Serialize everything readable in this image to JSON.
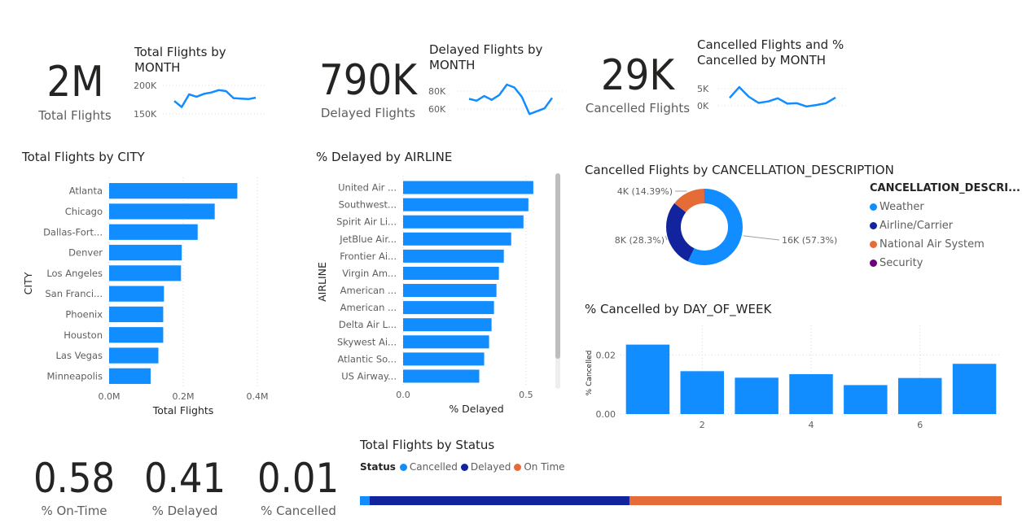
{
  "kpis": {
    "total_flights": {
      "value": "2M",
      "label": "Total Flights"
    },
    "delayed_flights": {
      "value": "790K",
      "label": "Delayed Flights"
    },
    "cancelled_flights": {
      "value": "29K",
      "label": "Cancelled Flights"
    },
    "on_time_pct": {
      "value": "0.58",
      "label": "% On-Time"
    },
    "delayed_pct": {
      "value": "0.41",
      "label": "% Delayed"
    },
    "cancelled_pct": {
      "value": "0.01",
      "label": "% Cancelled"
    }
  },
  "colors": {
    "blue": "#118DFF",
    "navy": "#12239E",
    "orange": "#E66C37",
    "purple": "#6B007B",
    "grid": "#d9d9d9",
    "text": "#252423",
    "muted": "#605e5c"
  },
  "chart_data": [
    {
      "type": "line",
      "title": "Total Flights by MONTH",
      "y_ticks": [
        "200K",
        "150K"
      ],
      "ylim": [
        130000,
        215000
      ],
      "x": [
        1,
        2,
        3,
        4,
        5,
        6,
        7,
        8,
        9,
        10,
        11,
        12
      ],
      "values": [
        168000,
        155000,
        182000,
        177000,
        183000,
        186000,
        191000,
        189000,
        174000,
        173000,
        172000,
        175000
      ]
    },
    {
      "type": "line",
      "title": "Delayed Flights by MONTH",
      "y_ticks": [
        "80K",
        "60K"
      ],
      "ylim": [
        50000,
        92000
      ],
      "x": [
        1,
        2,
        3,
        4,
        5,
        6,
        7,
        8,
        9,
        10,
        11,
        12
      ],
      "values": [
        71000,
        69000,
        74000,
        70000,
        75000,
        86000,
        83000,
        73000,
        55000,
        58000,
        61000,
        72000
      ]
    },
    {
      "type": "line",
      "title": "Cancelled Flights and % Cancelled by MONTH",
      "y_ticks": [
        "5K",
        "0K"
      ],
      "ylim": [
        -1500,
        8500
      ],
      "x": [
        1,
        2,
        3,
        4,
        5,
        6,
        7,
        8,
        9,
        10,
        11,
        12
      ],
      "values": [
        3200,
        6200,
        3500,
        1800,
        2200,
        3100,
        1600,
        1700,
        800,
        1200,
        1700,
        3300
      ]
    },
    {
      "type": "bar",
      "orientation": "horizontal",
      "title": "Total Flights by CITY",
      "xlabel": "Total Flights",
      "ylabel": "CITY",
      "categories": [
        "Atlanta",
        "Chicago",
        "Dallas-Fort...",
        "Denver",
        "Los Angeles",
        "San Franci...",
        "Phoenix",
        "Houston",
        "Las Vegas",
        "Minneapolis"
      ],
      "values": [
        346000,
        285000,
        239000,
        196000,
        194000,
        148000,
        146000,
        146000,
        133000,
        112000
      ],
      "xlim": [
        0,
        400000
      ],
      "x_ticks": [
        "0.0M",
        "0.2M",
        "0.4M"
      ]
    },
    {
      "type": "bar",
      "orientation": "horizontal",
      "title": "% Delayed by AIRLINE",
      "xlabel": "% Delayed",
      "ylabel": "AIRLINE",
      "categories": [
        "United Air ...",
        "Southwest...",
        "Spirit Air Li...",
        "JetBlue Air...",
        "Frontier Ai...",
        "Virgin Am...",
        "American ...",
        "American ...",
        "Delta Air L...",
        "Skywest Ai...",
        "Atlantic So...",
        "US Airway..."
      ],
      "values": [
        0.53,
        0.51,
        0.49,
        0.44,
        0.41,
        0.39,
        0.38,
        0.37,
        0.36,
        0.35,
        0.33,
        0.31
      ],
      "xlim": [
        0,
        0.6
      ],
      "x_ticks": [
        "0.0",
        "0.5"
      ]
    },
    {
      "type": "pie",
      "title": "Cancelled Flights by CANCELLATION_DESCRIPTION",
      "legend_title": "CANCELLATION_DESCRI...",
      "categories": [
        "Weather",
        "Airline/Carrier",
        "National Air System",
        "Security"
      ],
      "values": [
        16,
        8,
        4,
        0.022
      ],
      "data_labels": [
        "16K (57.3%)",
        "8K (28.3%)",
        "4K (14.39%)",
        ""
      ]
    },
    {
      "type": "bar",
      "title": "% Cancelled by DAY_OF_WEEK",
      "ylabel": "% Cancelled",
      "categories": [
        1,
        2,
        3,
        4,
        5,
        6,
        7
      ],
      "x_ticks": [
        "2",
        "4",
        "6"
      ],
      "values": [
        0.0235,
        0.0145,
        0.0123,
        0.0135,
        0.0098,
        0.0122,
        0.017
      ],
      "ylim": [
        0,
        0.03
      ],
      "y_ticks": [
        "0.00",
        "0.02"
      ]
    },
    {
      "type": "bar",
      "orientation": "stacked-horizontal",
      "title": "Total Flights by Status",
      "legend_title": "Status",
      "categories": [
        "Cancelled",
        "Delayed",
        "On Time"
      ],
      "values": [
        0.015,
        0.405,
        0.58
      ]
    }
  ]
}
